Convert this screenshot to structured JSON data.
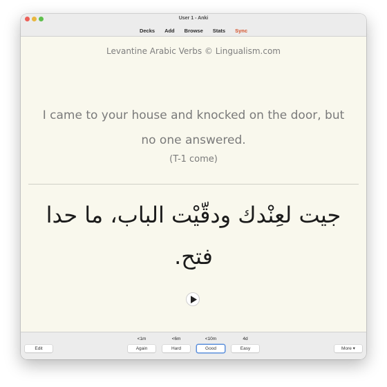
{
  "window": {
    "title": "User 1 - Anki"
  },
  "toolbar": {
    "items": [
      {
        "label": "Decks"
      },
      {
        "label": "Add"
      },
      {
        "label": "Browse"
      },
      {
        "label": "Stats"
      },
      {
        "label": "Sync",
        "color": "#d4532b"
      }
    ]
  },
  "card": {
    "deck_name": "Levantine Arabic Verbs © Lingualism.com",
    "front_text": "I came to your house and knocked on the door, but no one answered.",
    "hint": "(T-1 come)",
    "back_text": "جيت لعِنْدك ودقّيْت الباب، ما حدا فتح.",
    "play_icon": "play-icon"
  },
  "bottom": {
    "edit_label": "Edit",
    "more_label": "More ▾",
    "answers": [
      {
        "interval": "<1m",
        "label": "Again"
      },
      {
        "interval": "<6m",
        "label": "Hard"
      },
      {
        "interval": "<10m",
        "label": "Good",
        "focused": true
      },
      {
        "interval": "4d",
        "label": "Easy"
      }
    ]
  }
}
